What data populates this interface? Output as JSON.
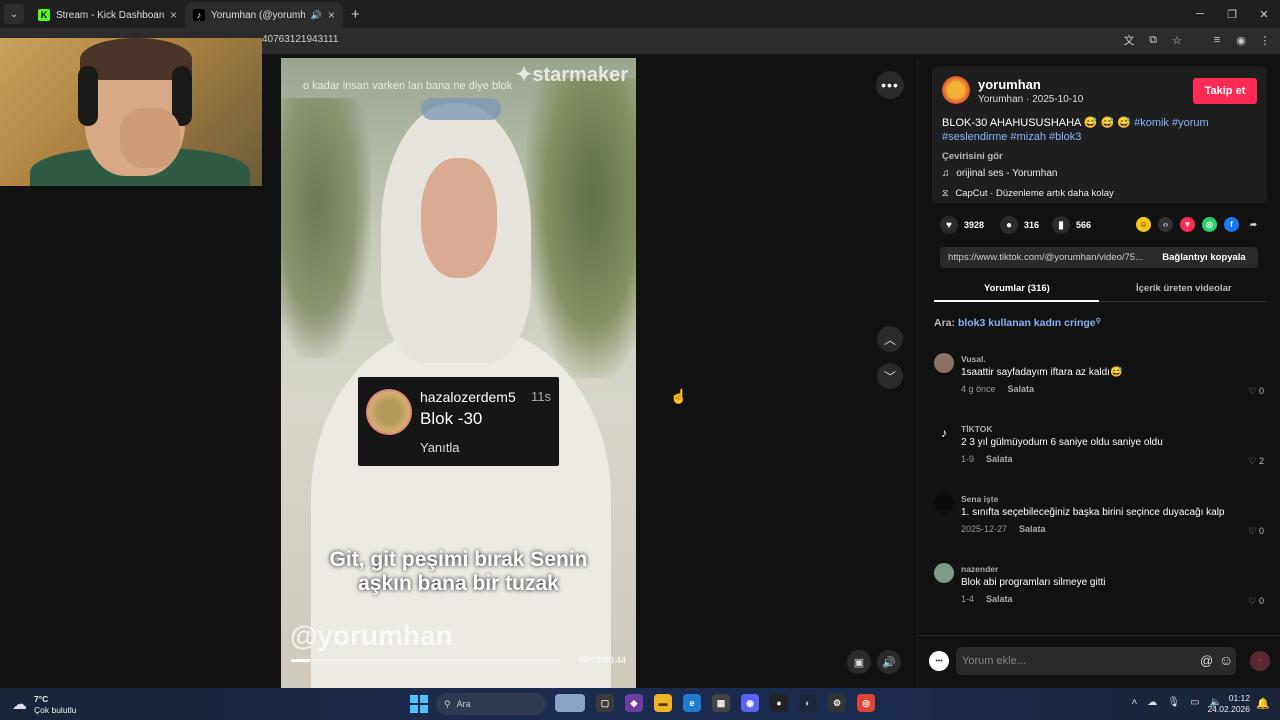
{
  "browser": {
    "tabs": [
      {
        "title": "Stream - Kick Dashboard",
        "favicon": "kick-icon"
      },
      {
        "title": "Yorumhan (@yorumhan) | T",
        "favicon": "tiktok-icon"
      }
    ],
    "url_fragment": "40763121943111"
  },
  "video": {
    "watermark": "✦starmaker",
    "top_overlay": "o kadar insan varken lan bana ne diye blok",
    "comment_card": {
      "user": "hazalozerdem5",
      "time": "11s",
      "text": "Blok -30",
      "reply": "Yanıtla"
    },
    "subtitle_line1": "Git, git peşimi bırak Senin",
    "subtitle_line2": "aşkın bana bir tuzak",
    "handle": "@yorumhan",
    "progress": 0.07,
    "time": "00:03/00:44"
  },
  "post": {
    "username": "yorumhan",
    "subline": "Yorumhan · 2025-10-10",
    "follow_label": "Takip et",
    "desc_text": "BLOK-30 AHAHUSUSHAHA 😅 😅 😅",
    "tags_line1": "#komik #yorum",
    "tags_line2": "#seslendirme #mizah #blok3",
    "translate": "Çevirisini gör",
    "music": "orijinal ses - Yorumhan",
    "capcut": "CapCut · Düzenleme artık daha kolay",
    "likes": "3928",
    "comments_count": "316",
    "saves": "566",
    "link": "https://www.tiktok.com/@yorumhan/video/75...",
    "copy_label": "Bağlantıyı kopyala",
    "tab_comments": "Yorumlar (316)",
    "tab_creator": "İçerik üreten videolar",
    "search_prefix": "Ara:",
    "search_query": "blok3 kullanan kadın cringe"
  },
  "comments": [
    {
      "user": "Vusal.",
      "text": "1saattir sayfadayım iftara az kaldı😅",
      "date": "4 g önce",
      "reply": "Salata",
      "likes": "0",
      "avatar_color": "#8a7066"
    },
    {
      "user": "TİKTOK",
      "text": "2 3 yıl gülmüyodum 6 saniye oldu saniye oldu",
      "date": "1-9",
      "reply": "Salata",
      "likes": "2",
      "avatar_color": "#111111"
    },
    {
      "user": "Sena işte",
      "text": "1. sınıfta seçebileceğiniz başka birini seçince duyacağı kalp",
      "date": "2025-12-27",
      "reply": "Salata",
      "likes": "0",
      "avatar_color": "#0a0a0a"
    },
    {
      "user": "nazender",
      "text": "Blok abi programları silmeye gitti",
      "date": "1-4",
      "reply": "Salata",
      "likes": "0",
      "avatar_color": "#7c9a8a"
    }
  ],
  "input": {
    "placeholder": "Yorum ekle...",
    "avatar_text": "•••"
  },
  "taskbar": {
    "temp": "7°C",
    "condition": "Çok bulutlu",
    "search": "Ara",
    "time": "01:12",
    "date": "24.02.2026"
  },
  "colors": {
    "follow": "#fe2c55",
    "link": "#8ab4f8",
    "panel_bg": "#121212"
  }
}
